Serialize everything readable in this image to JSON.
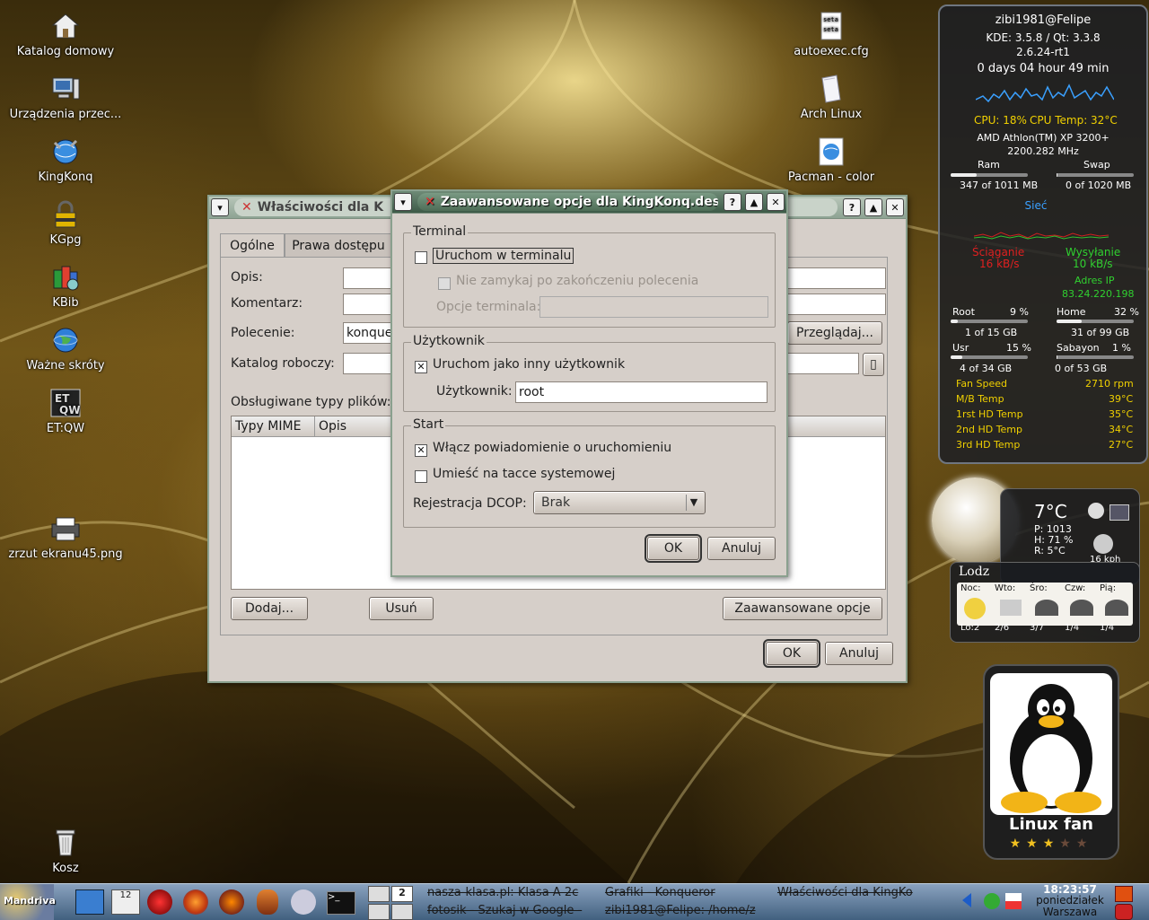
{
  "desktop_icons_left": [
    {
      "label": "Katalog domowy",
      "icon": "home-folder-icon"
    },
    {
      "label": "Urządzenia przec...",
      "icon": "computer-icon"
    },
    {
      "label": "KingKonq",
      "icon": "globe-icon"
    },
    {
      "label": "KGpg",
      "icon": "lock-icon"
    },
    {
      "label": "KBib",
      "icon": "books-icon"
    },
    {
      "label": "Ważne skróty",
      "icon": "globe-icon"
    },
    {
      "label": "ET:QW",
      "icon": "etqw-logo-icon"
    },
    {
      "label": "zrzut ekranu45.png",
      "icon": "printer-icon"
    },
    {
      "label": "Kosz",
      "icon": "trash-icon"
    }
  ],
  "desktop_icons_right": [
    {
      "label": "autoexec.cfg",
      "icon": "text-file-icon",
      "preview": "seta\nseta"
    },
    {
      "label": "Arch Linux",
      "icon": "file-icon"
    },
    {
      "label": "Pacman - color",
      "icon": "globe-icon"
    }
  ],
  "props_window": {
    "title": "Właściwości dla K",
    "tabs": [
      "Ogólne",
      "Prawa dostępu"
    ],
    "labels": {
      "opis": "Opis:",
      "komentarz": "Komentarz:",
      "polecenie": "Polecenie:",
      "katalog": "Katalog roboczy:",
      "typy": "Obsługiwane typy plików:"
    },
    "polecenie_value": "konquer",
    "browse_button": "Przeglądaj...",
    "columns": [
      "Typy MIME",
      "Opis"
    ],
    "buttons": {
      "add": "Dodaj...",
      "remove": "Usuń",
      "advanced": "Zaawansowane opcje",
      "ok": "OK",
      "cancel": "Anuluj"
    }
  },
  "adv_dialog": {
    "title": "Zaawansowane opcje dla KingKonq.desktop",
    "terminal_group": "Terminal",
    "run_in_terminal": "Uruchom w terminalu",
    "dont_close": "Nie zamykaj po zakończeniu polecenia",
    "terminal_options": "Opcje terminala:",
    "user_group": "Użytkownik",
    "run_as_other": "Uruchom jako inny użytkownik",
    "user_label": "Użytkownik:",
    "user_value": "root",
    "start_group": "Start",
    "startup_notify": "Włącz powiadomienie o uruchomieniu",
    "systray": "Umieść na tacce systemowej",
    "dcop_label": "Rejestracja DCOP:",
    "dcop_value": "Brak",
    "ok": "OK",
    "cancel": "Anuluj",
    "checks": {
      "run_in_terminal": false,
      "dont_close": false,
      "run_as_other": true,
      "startup_notify": true,
      "systray": false
    }
  },
  "sysmon": {
    "user_host": "zibi1981@Felipe",
    "kde_qt": "KDE: 3.5.8  /  Qt: 3.3.8",
    "kernel": "2.6.24-rt1",
    "uptime": "0 days  04 hour   49 min",
    "cpu": "CPU: 18%",
    "cpu_temp": "CPU Temp: 32°C",
    "cpu_model": "AMD Athlon(TM) XP 3200+",
    "cpu_mhz": "2200.282 MHz",
    "ram_label": "Ram",
    "swap_label": "Swap",
    "ram_value": "347 of 1011 MB",
    "swap_value": "0 of 1020 MB",
    "ram_fraction": 0.34,
    "swap_fraction": 0.0,
    "net_label": "Sieć",
    "download_label": "Ściąganie",
    "download_value": "16 kB/s",
    "upload_label": "Wysyłanie",
    "upload_value": "10 kB/s",
    "ip_label": "Adres IP",
    "ip_value": "83.24.220.198",
    "disks": [
      {
        "name": "Root",
        "pct": "9 %",
        "value": "1 of 15 GB",
        "fraction": 0.09
      },
      {
        "name": "Home",
        "pct": "32 %",
        "value": "31 of 99 GB",
        "fraction": 0.32
      },
      {
        "name": "Usr",
        "pct": "15 %",
        "value": "4 of 34 GB",
        "fraction": 0.15
      },
      {
        "name": "Sabayon",
        "pct": "1 %",
        "value": "0 of 53 GB",
        "fraction": 0.01
      }
    ],
    "sensors": [
      {
        "name": "Fan Speed",
        "value": "2710 rpm"
      },
      {
        "name": "M/B Temp",
        "value": "39°C"
      },
      {
        "name": "1rst HD Temp",
        "value": "35°C"
      },
      {
        "name": "2nd HD Temp",
        "value": "34°C"
      },
      {
        "name": "3rd HD Temp",
        "value": "27°C"
      }
    ]
  },
  "weather": {
    "temp": "7°C",
    "pressure": "P:  1013",
    "humidity": "H:  71 %",
    "real": "R:  5°C",
    "wind": "16 kph",
    "city": "Lodz",
    "days": [
      "Noc:",
      "Wto:",
      "Śro:",
      "Czw:",
      "Pią:"
    ],
    "lows": [
      "Lo:2",
      "2/6",
      "3/7",
      "1/4",
      "1/4"
    ]
  },
  "linux_fan": {
    "label": "Linux fan",
    "stars": 3,
    "max_stars": 5
  },
  "taskbar": {
    "start_label": "Mandriva",
    "desktop_number": "2",
    "tasks_top": [
      "nasza-klasa.pl: Klasa A 2c",
      "Grafiki - Konqueror",
      "Właściwości dla KingKo"
    ],
    "tasks_bottom": [
      "fotosik - Szukaj w Google -",
      "zibi1981@Felipe: /home/z"
    ],
    "time": "18:23:57",
    "day": "poniedziałek",
    "city": "Warszawa"
  }
}
